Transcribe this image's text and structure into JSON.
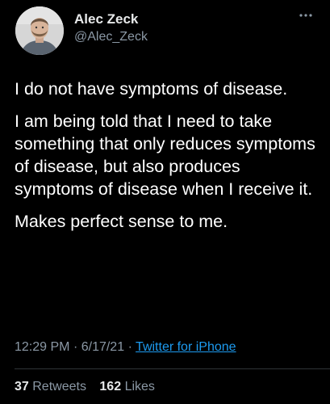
{
  "user": {
    "display_name": "Alec Zeck",
    "handle": "@Alec_Zeck"
  },
  "tweet": {
    "paragraphs": [
      "I do not have symptoms of disease.",
      "I am being told that I need to take something that only reduces symptoms of disease, but also produces symptoms of disease when I receive it.",
      "Makes perfect sense to me."
    ],
    "time": "12:29 PM",
    "date": "6/17/21",
    "separator": "·",
    "source": "Twitter for iPhone"
  },
  "stats": {
    "retweets_count": "37",
    "retweets_label": "Retweets",
    "likes_count": "162",
    "likes_label": "Likes"
  },
  "icons": {
    "more": "more-horizontal-icon",
    "avatar": "profile-photo"
  },
  "colors": {
    "background": "#000000",
    "text": "#ffffff",
    "secondary": "#8b98a5",
    "link": "#1d9bf0"
  }
}
